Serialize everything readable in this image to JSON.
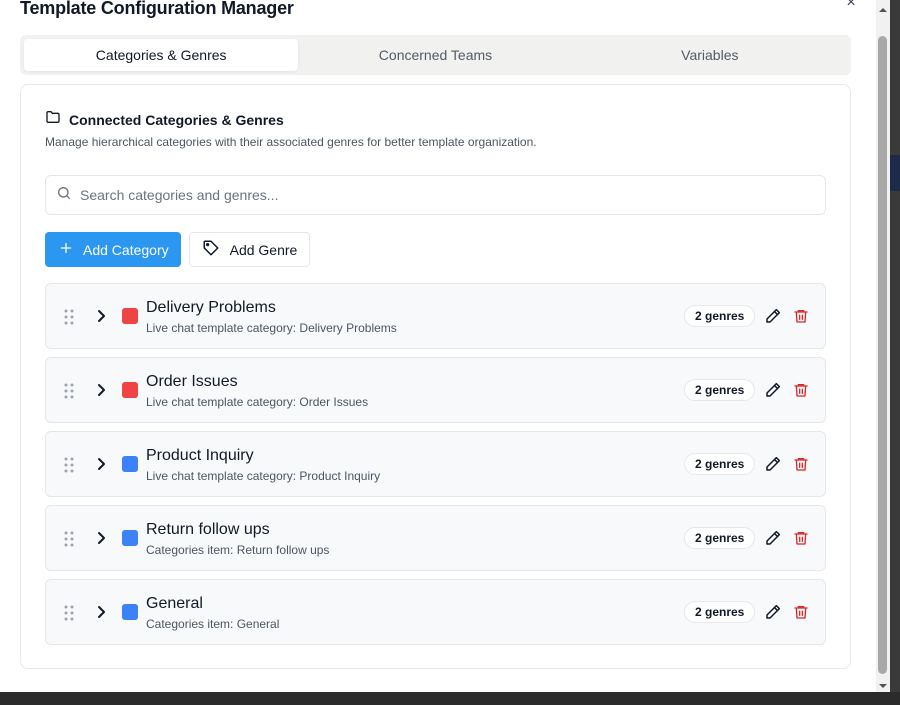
{
  "dialog": {
    "title": "Template Configuration Manager",
    "close_label": "×"
  },
  "tabs": [
    {
      "label": "Categories & Genres",
      "active": true
    },
    {
      "label": "Concerned Teams",
      "active": false
    },
    {
      "label": "Variables",
      "active": false
    }
  ],
  "section": {
    "title": "Connected Categories & Genres",
    "description": "Manage hierarchical categories with their associated genres for better template organization.",
    "icon": "folder-icon"
  },
  "search": {
    "placeholder": "Search categories and genres...",
    "value": ""
  },
  "actions": {
    "add_category_label": "Add Category",
    "add_genre_label": "Add Genre"
  },
  "colors": {
    "primary": "#2b97f0",
    "red_swatch": "#ef4444",
    "blue_swatch": "#3b82f6",
    "delete": "#dc2626"
  },
  "categories": [
    {
      "name": "Delivery Problems",
      "description": "Live chat template category: Delivery Problems",
      "color": "#ef4444",
      "genres_badge": "2 genres"
    },
    {
      "name": "Order Issues",
      "description": "Live chat template category: Order Issues",
      "color": "#ef4444",
      "genres_badge": "2 genres"
    },
    {
      "name": "Product Inquiry",
      "description": "Live chat template category: Product Inquiry",
      "color": "#3b82f6",
      "genres_badge": "2 genres"
    },
    {
      "name": "Return follow ups",
      "description": "Categories item: Return follow ups",
      "color": "#3b82f6",
      "genres_badge": "2 genres"
    },
    {
      "name": "General",
      "description": "Categories item: General",
      "color": "#3b82f6",
      "genres_badge": "2 genres"
    }
  ]
}
